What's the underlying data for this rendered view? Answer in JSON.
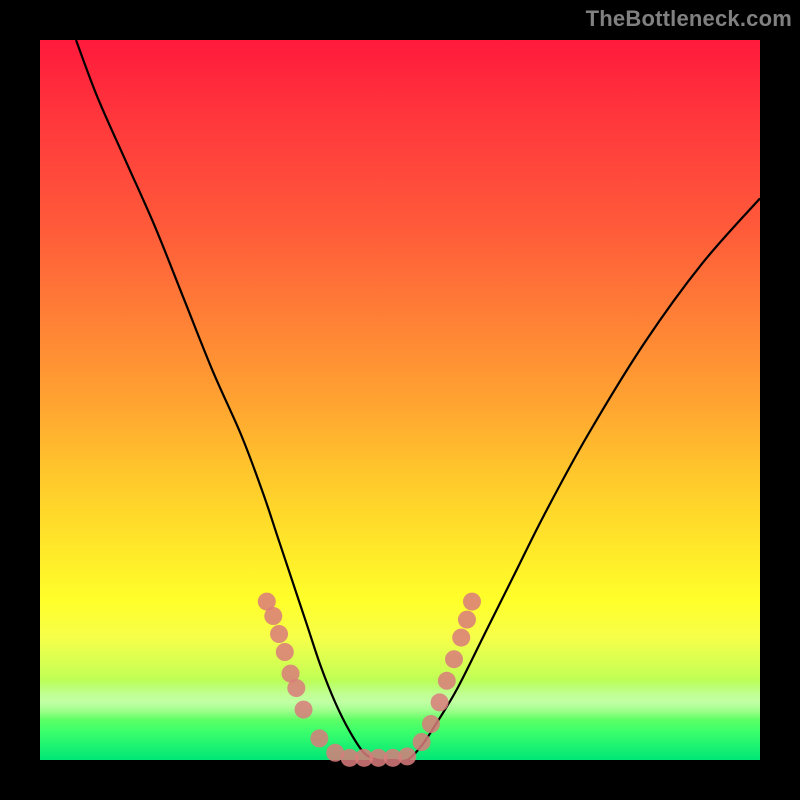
{
  "watermark": "TheBottleneck.com",
  "chart_data": {
    "type": "line",
    "title": "",
    "xlabel": "",
    "ylabel": "",
    "xlim": [
      0,
      100
    ],
    "ylim": [
      0,
      100
    ],
    "grid": false,
    "legend": false,
    "background_gradient": {
      "direction": "vertical",
      "stops": [
        {
          "pos": 0,
          "color": "#ff1a3c"
        },
        {
          "pos": 50,
          "color": "#ffa231"
        },
        {
          "pos": 78,
          "color": "#ffff2a"
        },
        {
          "pos": 100,
          "color": "#00e676"
        }
      ]
    },
    "series": [
      {
        "name": "bottleneck-curve",
        "color": "#000000",
        "x": [
          5,
          8,
          12,
          16,
          20,
          24,
          28,
          31,
          33,
          35,
          37,
          39,
          41,
          43,
          45,
          47,
          49,
          51,
          53,
          55,
          58,
          62,
          66,
          70,
          76,
          84,
          92,
          100
        ],
        "y": [
          100,
          92,
          83,
          74,
          64,
          54,
          45,
          37,
          31,
          25,
          19,
          13,
          8,
          4,
          1,
          0,
          0,
          0,
          2,
          5,
          10,
          18,
          26,
          34,
          45,
          58,
          69,
          78
        ]
      }
    ],
    "scatter_clusters": {
      "name": "sample-points",
      "color": "#d97b7b",
      "radius": 9,
      "points": [
        {
          "x": 31.5,
          "y": 22
        },
        {
          "x": 32.4,
          "y": 20
        },
        {
          "x": 33.2,
          "y": 17.5
        },
        {
          "x": 34.0,
          "y": 15
        },
        {
          "x": 34.8,
          "y": 12
        },
        {
          "x": 35.6,
          "y": 10
        },
        {
          "x": 36.6,
          "y": 7
        },
        {
          "x": 38.8,
          "y": 3
        },
        {
          "x": 41.0,
          "y": 1
        },
        {
          "x": 43.0,
          "y": 0.3
        },
        {
          "x": 45.0,
          "y": 0.3
        },
        {
          "x": 47.0,
          "y": 0.3
        },
        {
          "x": 49.0,
          "y": 0.3
        },
        {
          "x": 51.0,
          "y": 0.5
        },
        {
          "x": 53.0,
          "y": 2.5
        },
        {
          "x": 54.3,
          "y": 5
        },
        {
          "x": 55.5,
          "y": 8
        },
        {
          "x": 56.5,
          "y": 11
        },
        {
          "x": 57.5,
          "y": 14
        },
        {
          "x": 58.5,
          "y": 17
        },
        {
          "x": 59.3,
          "y": 19.5
        },
        {
          "x": 60.0,
          "y": 22
        }
      ]
    }
  }
}
